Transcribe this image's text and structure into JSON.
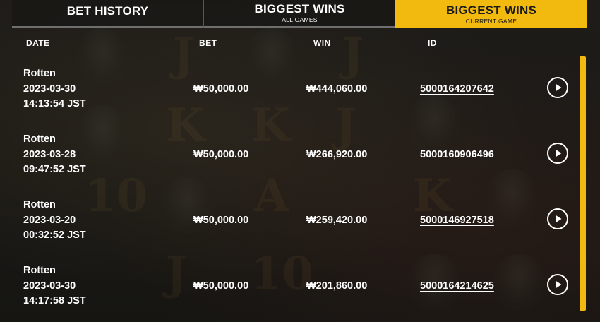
{
  "tabs": [
    {
      "label": "BET HISTORY",
      "sub": ""
    },
    {
      "label": "BIGGEST WINS",
      "sub": "ALL GAMES"
    },
    {
      "label": "BIGGEST WINS",
      "sub": "CURRENT GAME"
    }
  ],
  "active_tab": 2,
  "columns": {
    "date": "DATE",
    "bet": "BET",
    "win": "WIN",
    "id": "ID"
  },
  "rows": [
    {
      "game": "Rotten",
      "date": "2023-03-30",
      "time": "14:13:54 JST",
      "bet": "₩50,000.00",
      "win": "₩444,060.00",
      "id": "5000164207642"
    },
    {
      "game": "Rotten",
      "date": "2023-03-28",
      "time": "09:47:52 JST",
      "bet": "₩50,000.00",
      "win": "₩266,920.00",
      "id": "5000160906496"
    },
    {
      "game": "Rotten",
      "date": "2023-03-20",
      "time": "00:32:52 JST",
      "bet": "₩50,000.00",
      "win": "₩259,420.00",
      "id": "5000146927518"
    },
    {
      "game": "Rotten",
      "date": "2023-03-30",
      "time": "14:17:58 JST",
      "bet": "₩50,000.00",
      "win": "₩201,860.00",
      "id": "5000164214625"
    }
  ],
  "icons": {
    "play": "play-circle-icon"
  },
  "colors": {
    "accent": "#f2b90f",
    "text": "#ffffff",
    "background": "#1b1a17"
  }
}
